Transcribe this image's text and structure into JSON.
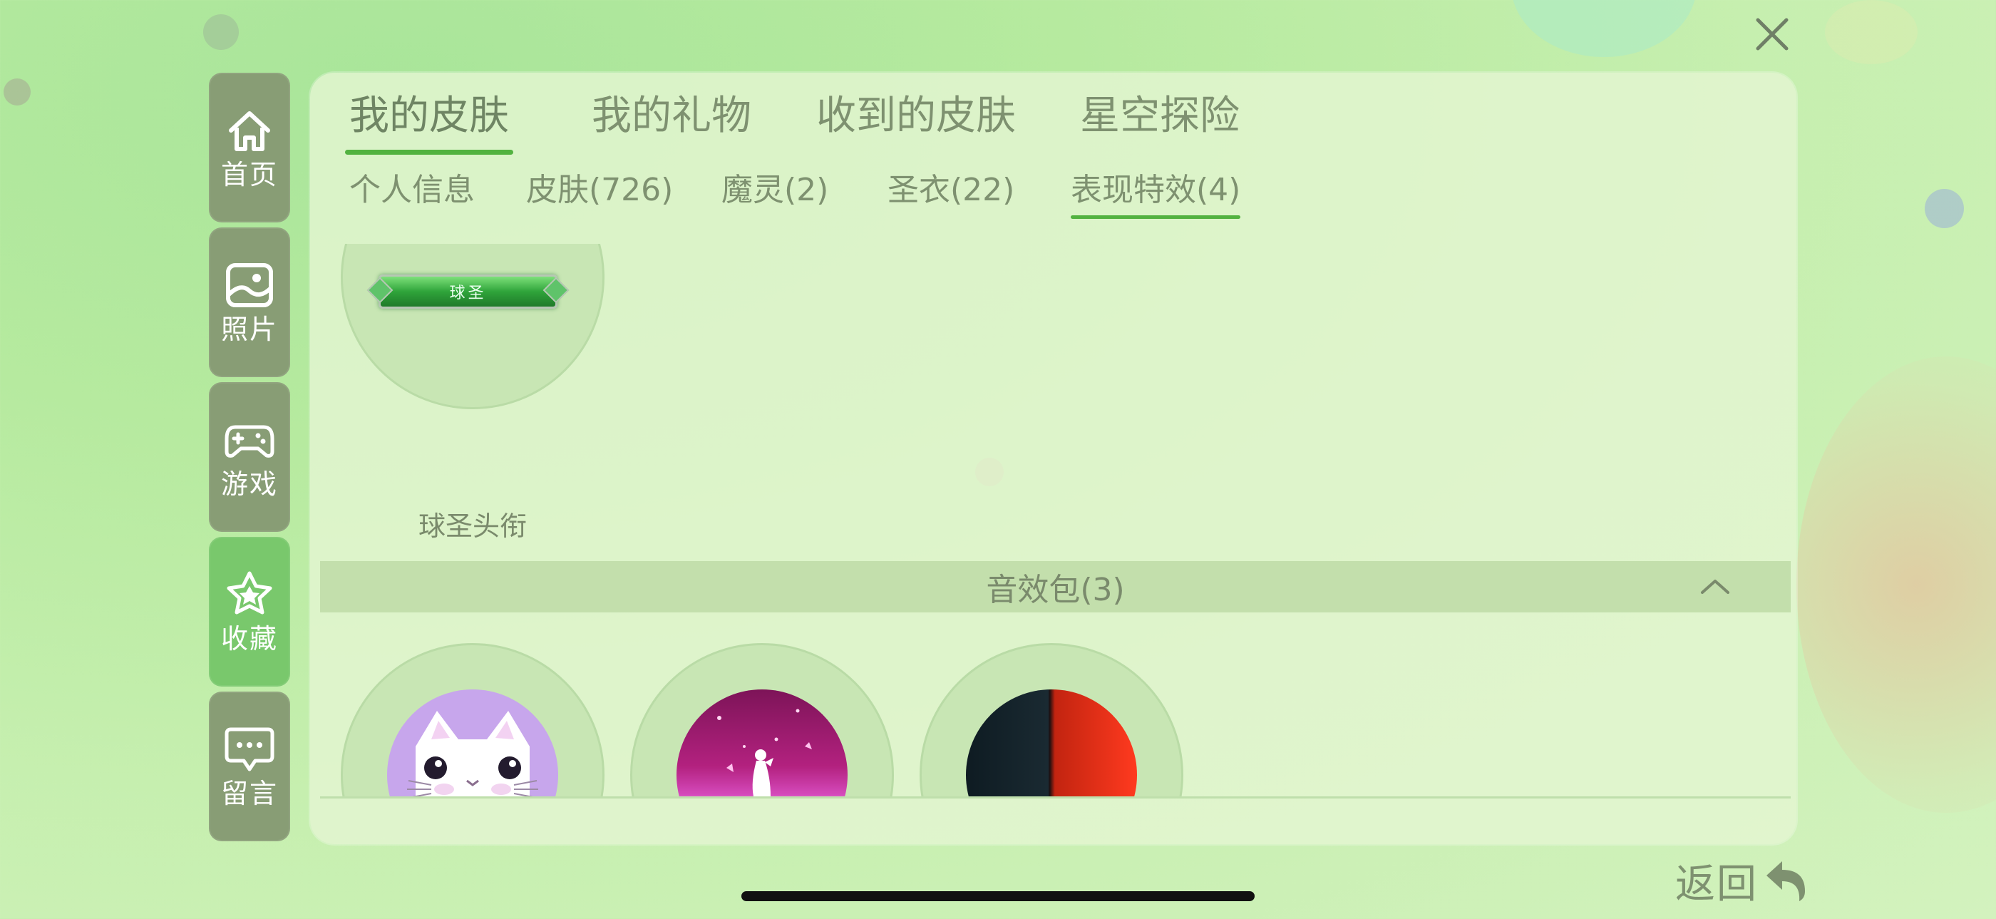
{
  "close": {
    "icon": "close-icon"
  },
  "sidebar": {
    "items": [
      {
        "label": "首页",
        "icon": "home-icon",
        "active": false
      },
      {
        "label": "照片",
        "icon": "photo-icon",
        "active": false
      },
      {
        "label": "游戏",
        "icon": "gamepad-icon",
        "active": false
      },
      {
        "label": "收藏",
        "icon": "star-icon",
        "active": true
      },
      {
        "label": "留言",
        "icon": "message-icon",
        "active": false
      }
    ]
  },
  "tabs": [
    {
      "label": "我的皮肤",
      "active": true
    },
    {
      "label": "我的礼物",
      "active": false
    },
    {
      "label": "收到的皮肤",
      "active": false
    },
    {
      "label": "星空探险",
      "active": false
    }
  ],
  "subtabs": [
    {
      "label": "个人信息",
      "active": false
    },
    {
      "label": "皮肤(726)",
      "active": false
    },
    {
      "label": "魔灵(2)",
      "active": false
    },
    {
      "label": "圣衣(22)",
      "active": false
    },
    {
      "label": "表现特效(4)",
      "active": true
    }
  ],
  "title_item": {
    "name": "球圣头衔",
    "badge_text": "球圣"
  },
  "sound_section": {
    "title": "音效包(3)",
    "expanded": true,
    "items": [
      {
        "thumb": "white-cat"
      },
      {
        "thumb": "pink-fairy"
      },
      {
        "thumb": "black-red-split"
      }
    ]
  },
  "back": {
    "label": "返回",
    "icon": "back-arrow-icon"
  },
  "colors": {
    "accent": "#52b240",
    "sidebar_bg": "#889d75",
    "sidebar_active": "#79c86c",
    "text": "#7e9170"
  }
}
